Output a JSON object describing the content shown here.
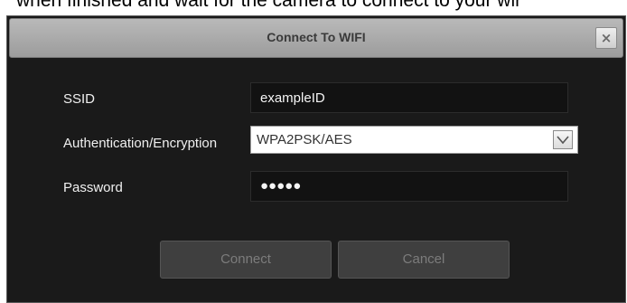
{
  "background": {
    "instruction_text": "when finished and wait for the camera to connect to your wir"
  },
  "dialog": {
    "title": "Connect To WIFI",
    "close_symbol": "×",
    "fields": {
      "ssid_label": "SSID",
      "ssid_value": "exampleID",
      "auth_label": "Authentication/Encryption",
      "auth_value": "WPA2PSK/AES",
      "password_label": "Password",
      "password_value": "●●●●●"
    },
    "buttons": {
      "connect_label": "Connect",
      "cancel_label": "Cancel"
    },
    "icons": {
      "close": "close-icon",
      "dropdown": "chevron-down-icon"
    },
    "colors": {
      "dialog_background": "#1a1a1a",
      "titlebar": "#a9a9a9",
      "button_background": "#3f3f3f",
      "button_text_disabled": "#7c7c7c"
    }
  }
}
